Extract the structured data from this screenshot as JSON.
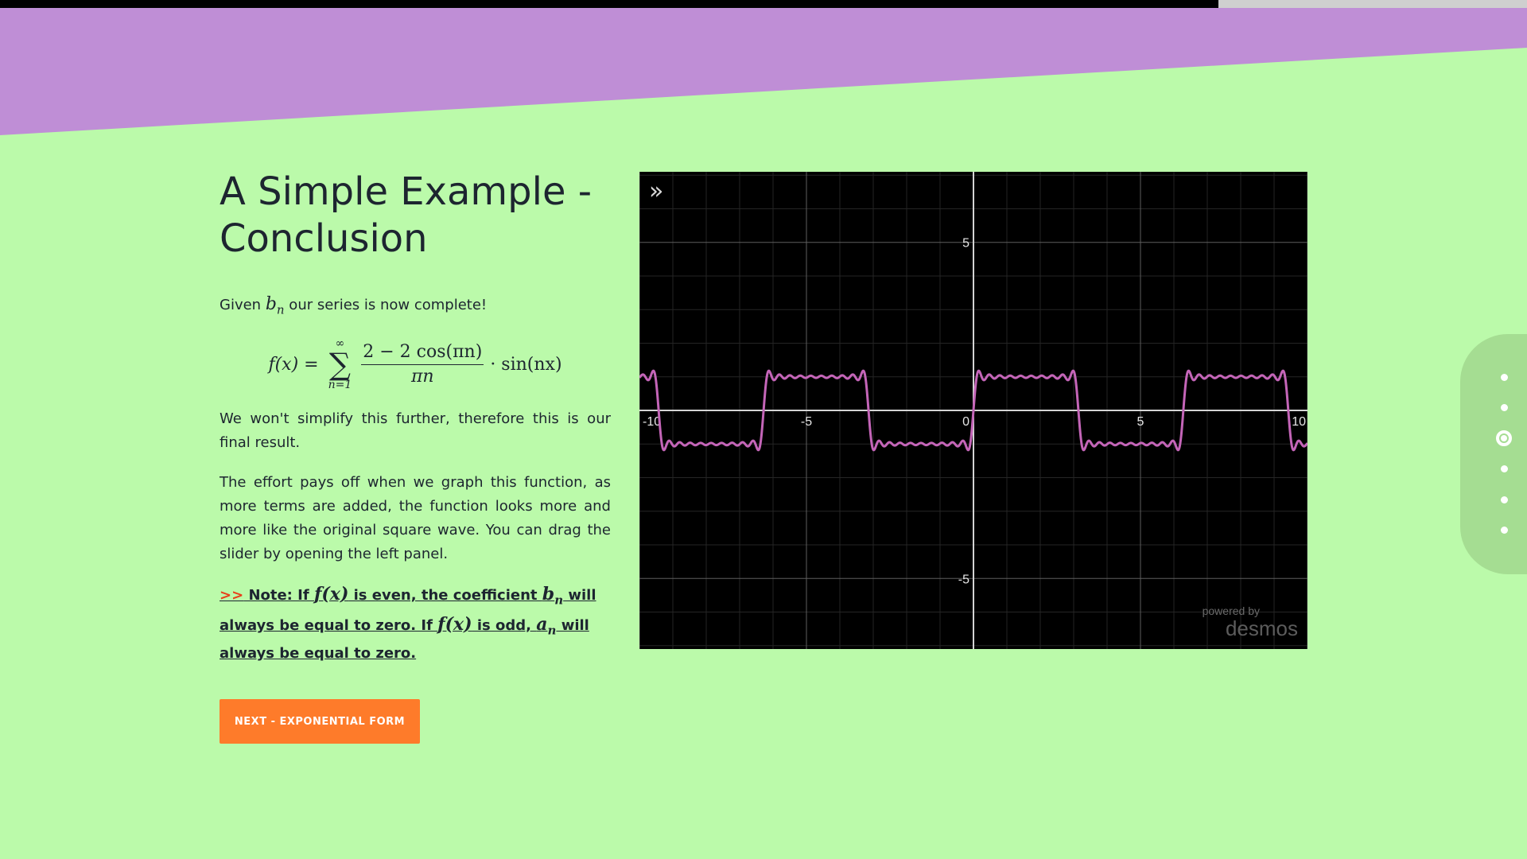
{
  "presentation": {
    "progress_fraction": 0.798
  },
  "colors": {
    "background": "#bbfaaa",
    "header": "#bf8ed6",
    "button": "#fe7b2a",
    "curve": "#c465b8",
    "note_arrow": "#e8401a"
  },
  "slide": {
    "title": "A Simple Example - Conclusion",
    "intro_before": "Given ",
    "intro_var": "b",
    "intro_sub": "n",
    "intro_after": " our series is now complete!",
    "formula": {
      "lhs": "f(x) =",
      "sum_top": "∞",
      "sum_symbol": "∑",
      "sum_bottom": "n=1",
      "numerator": "2 − 2 cos(πn)",
      "denominator": "πn",
      "tail": "· sin(nx)"
    },
    "para2": "We won't simplify this further, therefore this is our final result.",
    "para3": "The effort pays off when we graph this function, as more terms are added, the function looks more and more like the original square wave. You can drag the slider by opening the left panel.",
    "note": {
      "arrow": ">>",
      "t1": " Note: If ",
      "m1": "f(x)",
      "t2": " is even, the coefficient ",
      "m2": "b",
      "m2_sub": "n",
      "t3": " will always be equal to zero. If ",
      "m3": "f(x)",
      "t4": " is odd, ",
      "m4": "a",
      "m4_sub": "n",
      "t5": " will always be equal to zero."
    },
    "next_button": "NEXT - EXPONENTIAL FORM"
  },
  "graph": {
    "expand_icon": "»",
    "watermark_small": "powered by",
    "watermark_brand": "desmos"
  },
  "chart_data": {
    "type": "line",
    "series": [
      {
        "function": "sum_{n=1}^{N} (2 - 2cos(pi n))/(pi n) * sin(n x)",
        "terms": 19
      }
    ],
    "x_range": [
      -10,
      10
    ],
    "y_range": [
      -7.1,
      7.1
    ],
    "x_ticks": [
      -10,
      -5,
      0,
      5,
      10
    ],
    "y_ticks": [
      5,
      -5
    ],
    "grid": true,
    "theme": "dark"
  },
  "side_nav": {
    "dots": 6,
    "active_index": 2
  }
}
